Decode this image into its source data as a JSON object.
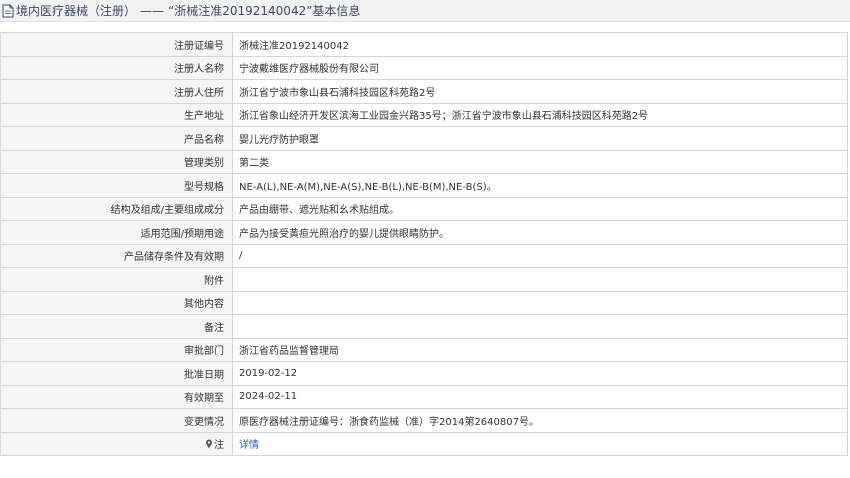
{
  "header": {
    "title": "境内医疗器械（注册）",
    "separator": "——",
    "record_title": "“浙械注准20192140042”基本信息"
  },
  "rows": [
    {
      "label": "注册证编号",
      "value": "浙械注准20192140042"
    },
    {
      "label": "注册人名称",
      "value": "宁波戴维医疗器械股份有限公司"
    },
    {
      "label": "注册人住所",
      "value": "浙江省宁波市象山县石浦科技园区科苑路2号"
    },
    {
      "label": "生产地址",
      "value": "浙江省象山经济开发区滨海工业园金兴路35号；浙江省宁波市象山县石浦科技园区科苑路2号"
    },
    {
      "label": "产品名称",
      "value": "婴儿光疗防护眼罩"
    },
    {
      "label": "管理类别",
      "value": "第二类"
    },
    {
      "label": "型号规格",
      "value": "NE-A(L),NE-A(M),NE-A(S),NE-B(L),NE-B(M),NE-B(S)。"
    },
    {
      "label": "结构及组成/主要组成成分",
      "value": "产品由绷带、遮光贴和幺术贴组成。"
    },
    {
      "label": "适用范围/预期用途",
      "value": "产品为接受黄疸光照治疗的婴儿提供眼睛防护。"
    },
    {
      "label": "产品储存条件及有效期",
      "value": "/"
    },
    {
      "label": "附件",
      "value": ""
    },
    {
      "label": "其他内容",
      "value": ""
    },
    {
      "label": "备注",
      "value": ""
    },
    {
      "label": "审批部门",
      "value": "浙江省药品监督管理局"
    },
    {
      "label": "批准日期",
      "value": "2019-02-12"
    },
    {
      "label": "有效期至",
      "value": "2024-02-11"
    },
    {
      "label": "变更情况",
      "value": "原医疗器械注册证编号：浙食药监械（准）字2014第2640807号。"
    }
  ],
  "note_row": {
    "label": "注",
    "link": "详情",
    "icon": "pin-icon"
  }
}
